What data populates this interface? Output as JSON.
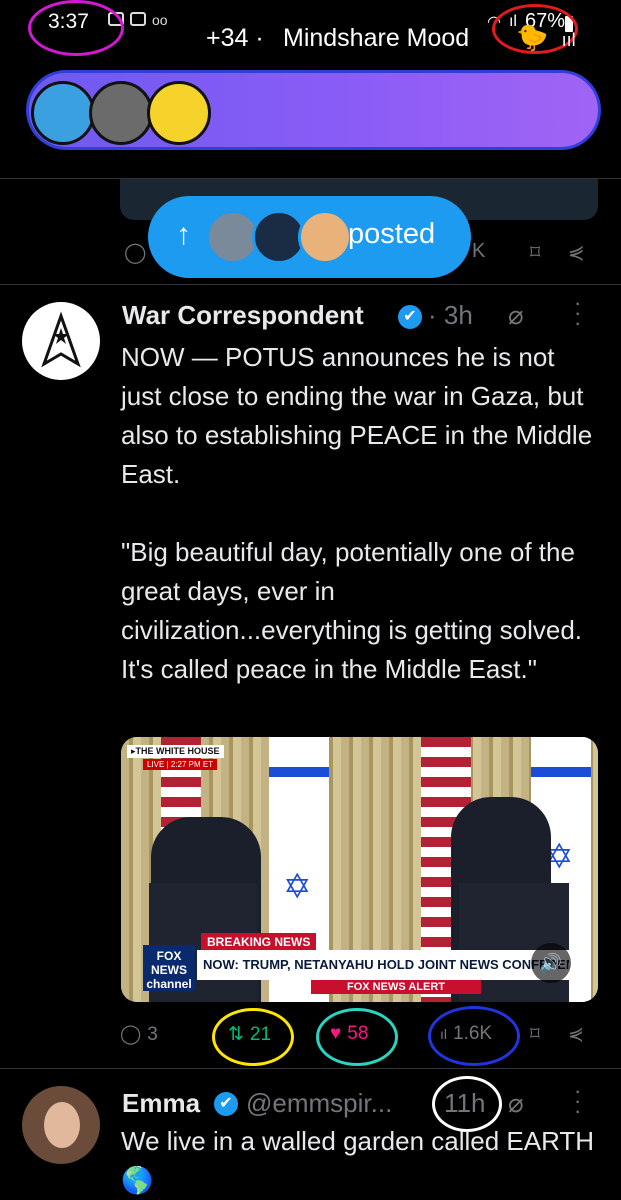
{
  "status_bar": {
    "time": "3:37",
    "battery": "67%"
  },
  "banner": {
    "count": "+34 ·",
    "title": "Mindshare Mood",
    "emoji": "🐤",
    "bars_icon": "ııl"
  },
  "posted_pill": {
    "arrow": "↑",
    "label": "posted"
  },
  "peek_actions": {
    "views": "K"
  },
  "tweet": {
    "author": "War Correspondent",
    "verified_mark": "✔",
    "time": "· 3h",
    "text": "NOW — POTUS announces he is not just close to ending the war in Gaza, but also to establishing PEACE in the Middle East.\n\n\"Big beautiful day, potentially one of the great days, ever in civilization...everything is getting solved. It's called peace in the Middle East.\"",
    "media": {
      "wh_label": "▸THE WHITE HOUSE",
      "live_label": "LIVE | 2:27 PM ET",
      "breaking": "BREAKING NEWS",
      "chyron": "NOW: TRUMP, NETANYAHU HOLD JOINT NEWS CONFERENCE",
      "network": "FOX NEWS channel",
      "alert": "FOX NEWS ALERT",
      "sound_icon": "🔊"
    },
    "replies": "3",
    "reposts": "21",
    "likes": "58",
    "views": "1.6K"
  },
  "next_tweet": {
    "author": "Emma",
    "handle": "@emmspir...",
    "time": "11h",
    "text": "We live in a walled garden called EARTH🌎"
  },
  "colors": {
    "accent": "#1d9bf0",
    "like": "#f91880",
    "repost": "#00ba7c",
    "muted": "#71767b"
  }
}
